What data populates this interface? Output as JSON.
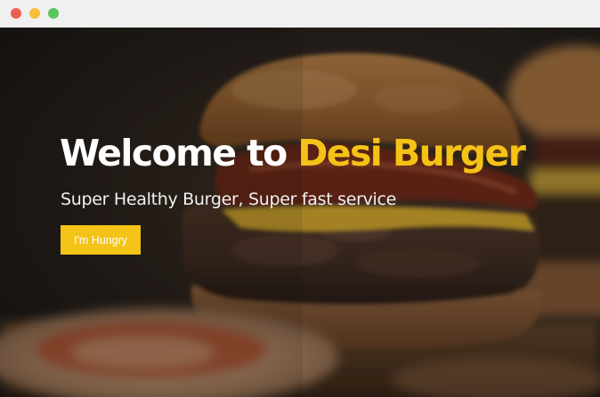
{
  "window": {
    "controls": [
      "close",
      "minimize",
      "maximize"
    ],
    "control_colors": {
      "close": "#ee5d55",
      "minimize": "#f5bd3a",
      "maximize": "#5ac75c"
    }
  },
  "hero": {
    "headline_prefix": "Welcome to ",
    "headline_brand": "Desi Burger",
    "subheadline": "Super Healthy Burger, Super fast service",
    "cta_label": "I'm Hungry",
    "background": "burger-photo"
  },
  "colors": {
    "accent": "#f5c216",
    "button": "#f3c417",
    "text": "#ffffff"
  }
}
